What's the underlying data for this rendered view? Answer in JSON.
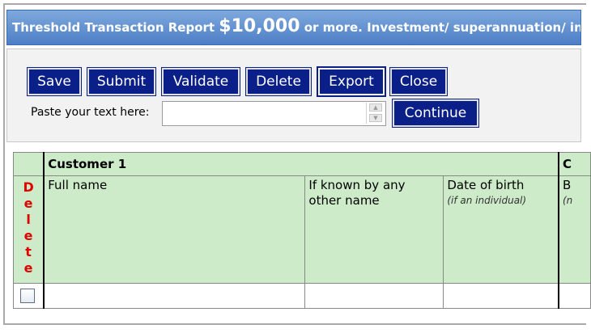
{
  "title": {
    "prefix": "Threshold Transaction Report ",
    "amount": "$10,000",
    "suffix": " or more. Investment/ superannuation/ ins"
  },
  "toolbar": {
    "save": "Save",
    "submit": "Submit",
    "validate": "Validate",
    "delete": "Delete",
    "export": "Export",
    "close": "Close"
  },
  "paste": {
    "label": "Paste your text here:",
    "value": "",
    "continue": "Continue"
  },
  "grid": {
    "section_title": "Customer 1",
    "section_title_next": "C",
    "delete_letters": [
      "D",
      "e",
      "l",
      "e",
      "t",
      "e"
    ],
    "columns": {
      "full_name": "Full name",
      "other_name": "If known by any other name",
      "dob": "Date of birth",
      "dob_note": "(if an individual)",
      "next": "B",
      "next_note": "(n"
    },
    "row": {
      "full_name": "",
      "other_name": "",
      "dob": ""
    }
  }
}
